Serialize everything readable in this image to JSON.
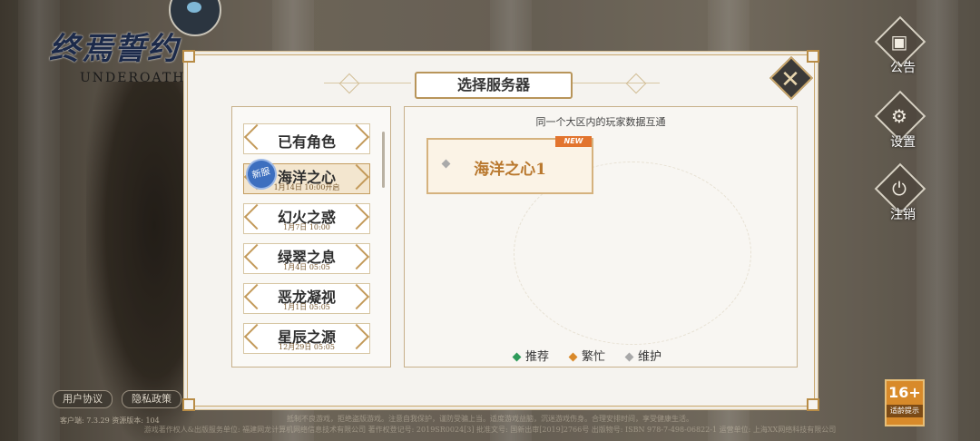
{
  "background": {
    "avatar_color": "#2b3540"
  },
  "logo": {
    "cn": "终焉誓约",
    "en": "UNDEROATH"
  },
  "side_menu": {
    "notice": {
      "label": "公告",
      "icon": "notice-board-icon"
    },
    "settings": {
      "label": "设置",
      "icon": "gear-icon"
    },
    "logout": {
      "label": "注销",
      "icon": "power-icon"
    }
  },
  "footer": {
    "user_agreement": "用户协议",
    "privacy_policy": "隐私政策",
    "version": "客户端: 7.3.29 资源版本: 104",
    "age_rating": "16+",
    "age_label": "适龄提示",
    "notice_line1": "抵制不良游戏，拒绝盗版游戏。注意自我保护，谨防受骗上当。适度游戏益脑，沉迷游戏伤身。合理安排时间，享受健康生活。",
    "notice_line2": "游戏著作权人&出版服务单位: 福建网龙计算机网络信息技术有限公司  著作权登记号: 2019SR0024[3]  批准文号: 国新出审[2019]2766号  出版物号: ISBN 978-7-498-06822-1  运营单位: 上海XX网络科技有限公司"
  },
  "panel": {
    "title": "选择服务器",
    "close_icon": "close-icon",
    "region_note": "同一个大区内的玩家数据互通",
    "servers": [
      {
        "name": "已有角色",
        "time": "",
        "selected": false,
        "new": false
      },
      {
        "name": "海洋之心",
        "time": "1月14日 10:00开启",
        "selected": true,
        "new": true,
        "badge": "新服"
      },
      {
        "name": "幻火之惑",
        "time": "1月7日 10:00",
        "selected": false,
        "new": false
      },
      {
        "name": "绿翠之息",
        "time": "1月4日 05:05",
        "selected": false,
        "new": false
      },
      {
        "name": "恶龙凝视",
        "time": "1月1日 05:05",
        "selected": false,
        "new": false
      },
      {
        "name": "星辰之源",
        "time": "12月29日 05:05",
        "selected": false,
        "new": false
      }
    ],
    "server_card": {
      "name": "海洋之心1",
      "tag": "NEW",
      "status": "maintenance"
    },
    "legend": [
      {
        "label": "推荐",
        "color": "#2e9b5a"
      },
      {
        "label": "繁忙",
        "color": "#d9892a"
      },
      {
        "label": "维护",
        "color": "#a8a8a8"
      }
    ]
  }
}
